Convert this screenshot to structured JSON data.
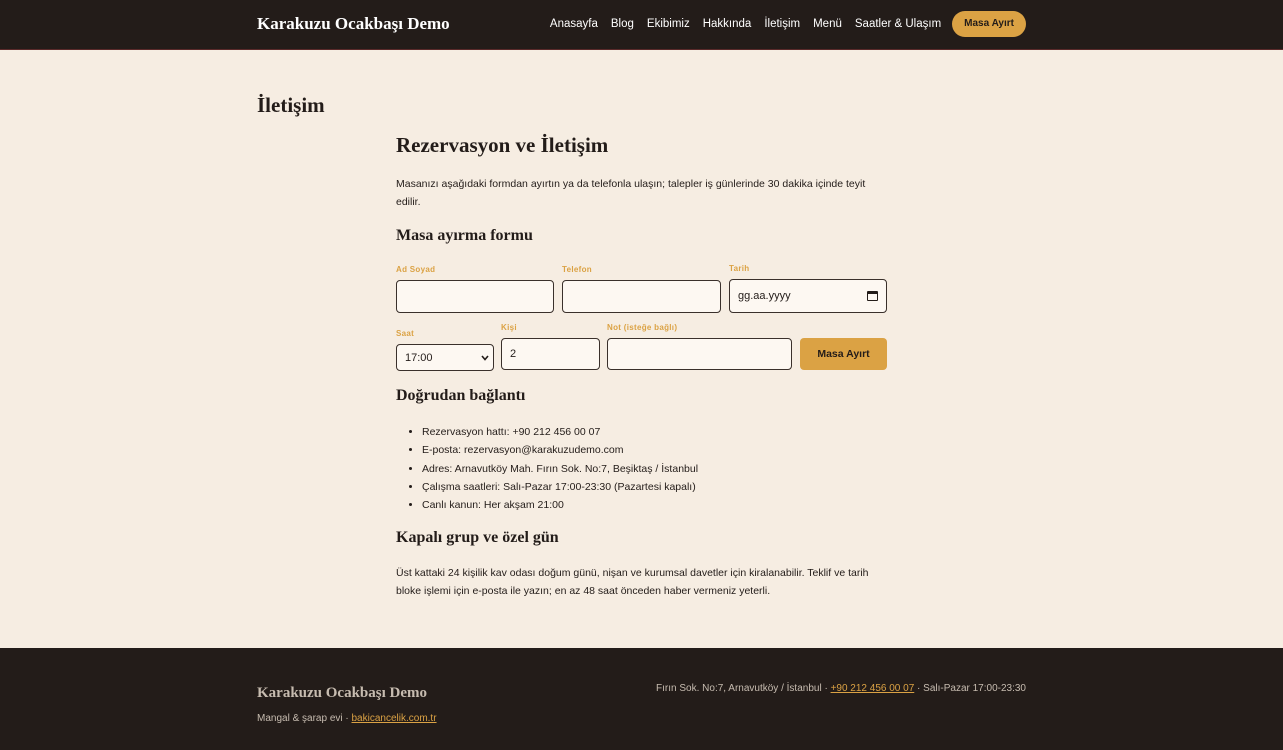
{
  "header": {
    "brand": "Karakuzu Ocakbaşı Demo",
    "nav": [
      "Anasayfa",
      "Blog",
      "Ekibimiz",
      "Hakkında",
      "İletişim",
      "Menü",
      "Saatler & Ulaşım"
    ],
    "cta": "Masa Ayırt"
  },
  "page": {
    "title": "İletişim"
  },
  "main": {
    "heading": "Rezervasyon ve İletişim",
    "intro": "Masanızı aşağıdaki formdan ayırtın ya da telefonla ulaşın; talepler iş günlerinde 30 dakika içinde teyit edilir.",
    "form": {
      "heading": "Masa ayırma formu",
      "name_label": "Ad Soyad",
      "name_value": "",
      "phone_label": "Telefon",
      "phone_value": "",
      "date_label": "Tarih",
      "date_value": "gg.aa.yyyy",
      "time_label": "Saat",
      "time_value": "17:00",
      "guests_label": "Kişi",
      "guests_value": "2",
      "note_label": "Not (isteğe bağlı)",
      "note_value": "",
      "submit": "Masa Ayırt"
    },
    "direct": {
      "heading": "Doğrudan bağlantı",
      "items": [
        "Rezervasyon hattı: +90 212 456 00 07",
        "E-posta: rezervasyon@karakuzudemo.com",
        "Adres: Arnavutköy Mah. Fırın Sok. No:7, Beşiktaş / İstanbul",
        "Çalışma saatleri: Salı-Pazar 17:00-23:30 (Pazartesi kapalı)",
        "Canlı kanun: Her akşam 21:00"
      ]
    },
    "group": {
      "heading": "Kapalı grup ve özel gün",
      "text": "Üst kattaki 24 kişilik kav odası doğum günü, nişan ve kurumsal davetler için kiralanabilir. Teklif ve tarih bloke işlemi için e-posta ile yazın; en az 48 saat önceden haber vermeniz yeterli."
    }
  },
  "footer": {
    "brand": "Karakuzu Ocakbaşı Demo",
    "tagline": "Mangal & şarap evi · ",
    "tag_link": "bakicancelik.com.tr",
    "address": "Fırın Sok. No:7, Arnavutköy / İstanbul · ",
    "phone": "+90 212 456 00 07",
    "hours": " · Salı-Pazar 17:00-23:30"
  },
  "colors": {
    "accent": "#dba244",
    "dark": "#231c19",
    "background": "#f6ede2"
  }
}
